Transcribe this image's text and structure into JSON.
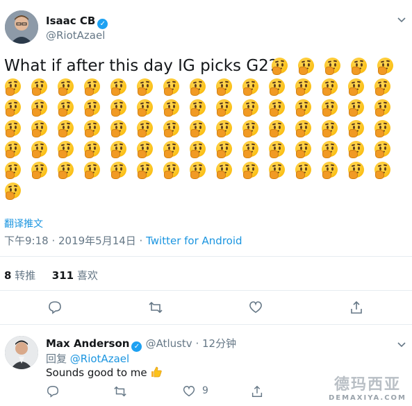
{
  "tweet": {
    "author_name": "Isaac CB",
    "author_handle": "@RiotAzael",
    "text": "What if after this day IG picks G2?",
    "emoji_name": "thinking-face-icon",
    "translate_label": "翻译推文",
    "timestamp": "下午9:18 · 2019年5月14日 · ",
    "source": "Twitter for Android",
    "retweet_count": "8",
    "retweet_label": " 转推",
    "like_count": "311",
    "like_label": " 喜欢"
  },
  "reply": {
    "author_name": "Max Anderson",
    "author_handle": "@Atlustv",
    "time": " · 12分钟",
    "replying_label": "回复 ",
    "replying_to": "@RiotAzael",
    "text": "Sounds good to me",
    "like_count": "9"
  },
  "watermark": {
    "title": "德玛西亚",
    "subtitle": "DEMAXIYA.COM"
  },
  "colors": {
    "link": "#1b95e0",
    "verified": "#1da1f2",
    "muted": "#657786"
  }
}
